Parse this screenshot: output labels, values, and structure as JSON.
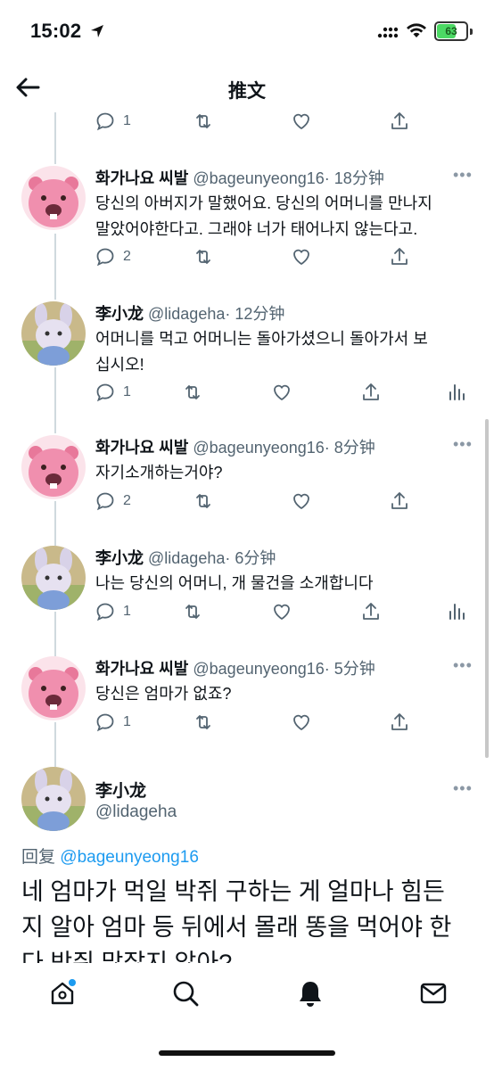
{
  "status_bar": {
    "time": "15:02",
    "battery": "63"
  },
  "header": {
    "title": "推文"
  },
  "top_actions": {
    "reply_count": "1"
  },
  "tweets": [
    {
      "name": "화가나요 씨발",
      "handle": "@bageunyeong16",
      "time": "· 18分钟",
      "lines": [
        "당신의 아버지가 말했어요. 당신의 어머니를 만나지",
        "말았어야한다고. 그래야 너가 태어나지 않는다고."
      ],
      "reply_count": "2",
      "avatar": "beaver"
    },
    {
      "name": "李小龙",
      "handle": "@lidageha",
      "time": "· 12分钟",
      "lines": [
        "어머니를 먹고 어머니는 돌아가셨으니 돌아가서 보",
        "십시오!"
      ],
      "reply_count": "1",
      "avatar": "rabbit"
    },
    {
      "name": "화가나요 씨발",
      "handle": "@bageunyeong16",
      "time": "· 8分钟",
      "lines": [
        "자기소개하는거야?"
      ],
      "reply_count": "2",
      "avatar": "beaver"
    },
    {
      "name": "李小龙",
      "handle": "@lidageha",
      "time": "· 6分钟",
      "lines": [
        "나는 당신의 어머니, 개 물건을 소개합니다"
      ],
      "reply_count": "1",
      "avatar": "rabbit"
    },
    {
      "name": "화가나요 씨발",
      "handle": "@bageunyeong16",
      "time": "· 5分钟",
      "lines": [
        "당신은 엄마가 없죠?"
      ],
      "reply_count": "1",
      "avatar": "beaver"
    }
  ],
  "main_tweet": {
    "name": "李小龙",
    "handle": "@lidageha",
    "reply_label": "回复",
    "reply_to": "@bageunyeong16",
    "lines": [
      "네 엄마가 먹일 박쥐 구하는 게 얼마나 힘든",
      "지 알아 엄마 등 뒤에서 몰래 똥을 먹어야 한",
      "다 박쥐 많잖지 않아?"
    ]
  },
  "more_label": "•••",
  "colors": {
    "accent": "#1d9bf0",
    "muted": "#536471",
    "divider": "#cfd9de"
  },
  "nav": [
    "home-icon",
    "search-icon",
    "notifications-icon",
    "messages-icon"
  ]
}
